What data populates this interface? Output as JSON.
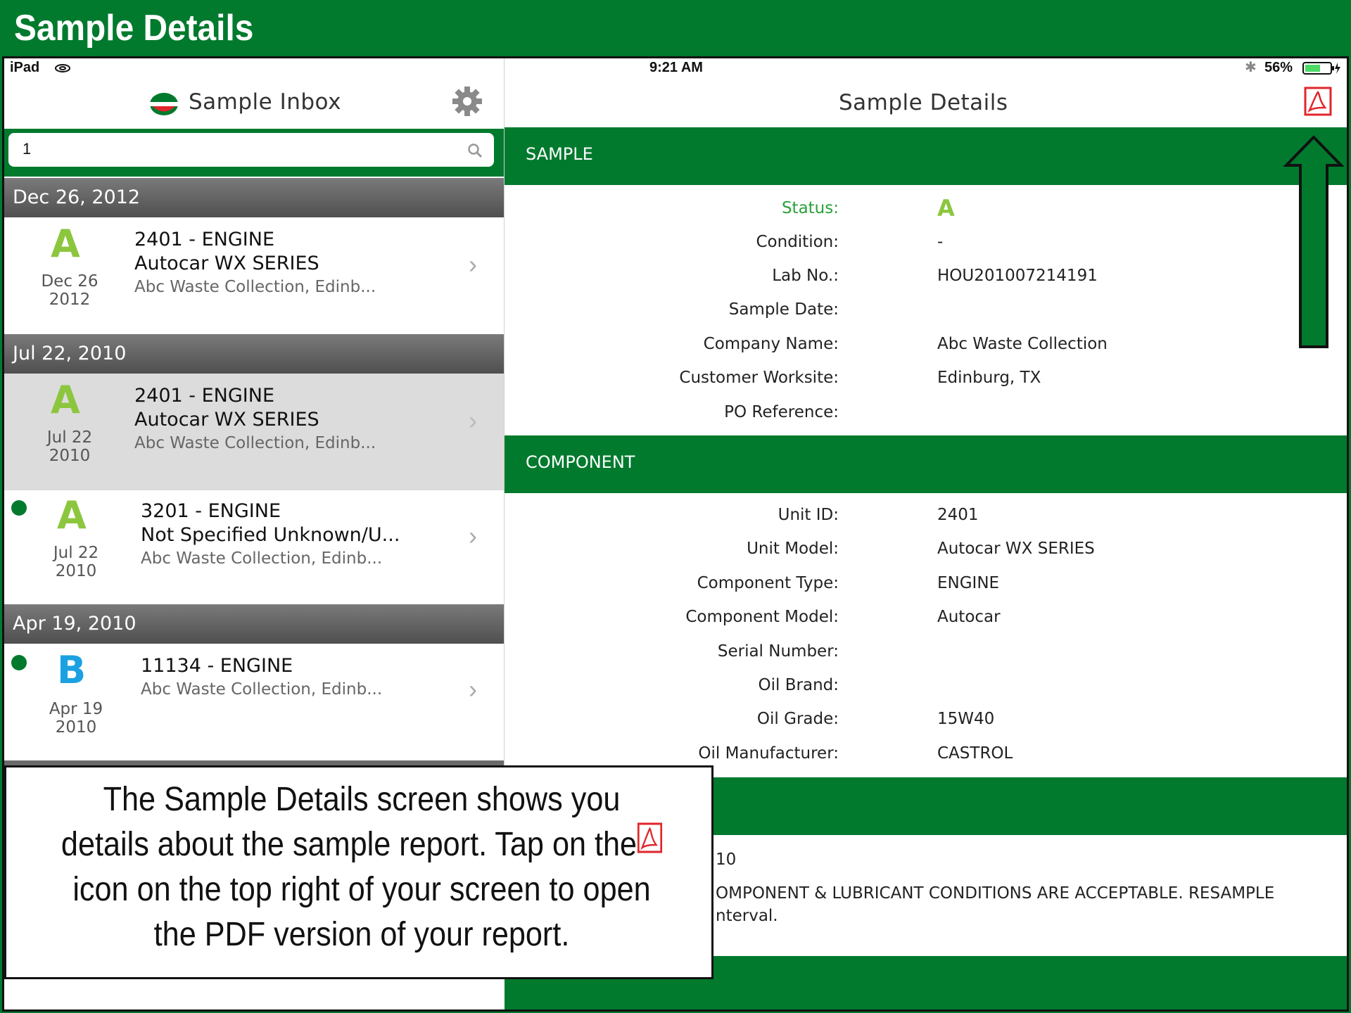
{
  "banner": {
    "title": "Sample Details"
  },
  "status_bar": {
    "device": "iPad",
    "time": "9:21 AM",
    "battery": "56%"
  },
  "inbox": {
    "title": "Sample Inbox",
    "search_value": "1",
    "sections": [
      {
        "date": "Dec 26, 2012",
        "items": [
          {
            "grade": "A",
            "date_line1": "Dec 26",
            "date_line2": "2012",
            "title": "2401 - ENGINE",
            "subtitle": "Autocar WX SERIES",
            "company": "Abc Waste Collection, Edinb...",
            "unread": false,
            "selected": false
          }
        ]
      },
      {
        "date": "Jul 22, 2010",
        "items": [
          {
            "grade": "A",
            "date_line1": "Jul 22",
            "date_line2": "2010",
            "title": "2401 - ENGINE",
            "subtitle": "Autocar WX SERIES",
            "company": "Abc Waste Collection, Edinb...",
            "unread": false,
            "selected": true
          },
          {
            "grade": "A",
            "date_line1": "Jul 22",
            "date_line2": "2010",
            "title": "3201 - ENGINE",
            "subtitle": "Not Specified Unknown/U...",
            "company": "Abc Waste Collection, Edinb...",
            "unread": true,
            "selected": false
          }
        ]
      },
      {
        "date": "Apr 19, 2010",
        "items": [
          {
            "grade": "B",
            "date_line1": "Apr 19",
            "date_line2": "2010",
            "title": "11134 - ENGINE",
            "subtitle": "",
            "company": "Abc Waste Collection, Edinb...",
            "unread": true,
            "selected": false
          }
        ]
      }
    ]
  },
  "details": {
    "title": "Sample Details",
    "sample_header": "SAMPLE",
    "sample_fields": [
      {
        "label": "Status:",
        "value": "A"
      },
      {
        "label": "Condition:",
        "value": "-"
      },
      {
        "label": "Lab No.:",
        "value": "HOU201007214191"
      },
      {
        "label": "Sample Date:",
        "value": ""
      },
      {
        "label": "Company Name:",
        "value": "Abc Waste Collection"
      },
      {
        "label": "Customer Worksite:",
        "value": "Edinburg, TX"
      },
      {
        "label": "PO Reference:",
        "value": ""
      }
    ],
    "component_header": "COMPONENT",
    "component_fields": [
      {
        "label": "Unit ID:",
        "value": "2401"
      },
      {
        "label": "Unit Model:",
        "value": "Autocar WX SERIES"
      },
      {
        "label": "Component Type:",
        "value": "ENGINE"
      },
      {
        "label": "Component Model:",
        "value": "Autocar"
      },
      {
        "label": "Serial Number:",
        "value": ""
      },
      {
        "label": "Oil Brand:",
        "value": ""
      },
      {
        "label": "Oil Grade:",
        "value": "15W40"
      },
      {
        "label": "Oil Manufacturer:",
        "value": "CASTROL"
      }
    ],
    "comment_line1": "10",
    "comment_line2": "OMPONENT & LUBRICANT CONDITIONS ARE ACCEPTABLE. RESAMPLE",
    "comment_line3": "nterval."
  },
  "callout": {
    "text_before": "The Sample Details screen shows you details about the sample report.  Tap on the",
    "text_after": " icon on the top right of your screen to open the PDF version of your report."
  },
  "colors": {
    "brand_green": "#017a2e",
    "grade_a": "#8cc63f",
    "grade_b": "#1ba1e2",
    "pdf_red": "#e0262b"
  }
}
